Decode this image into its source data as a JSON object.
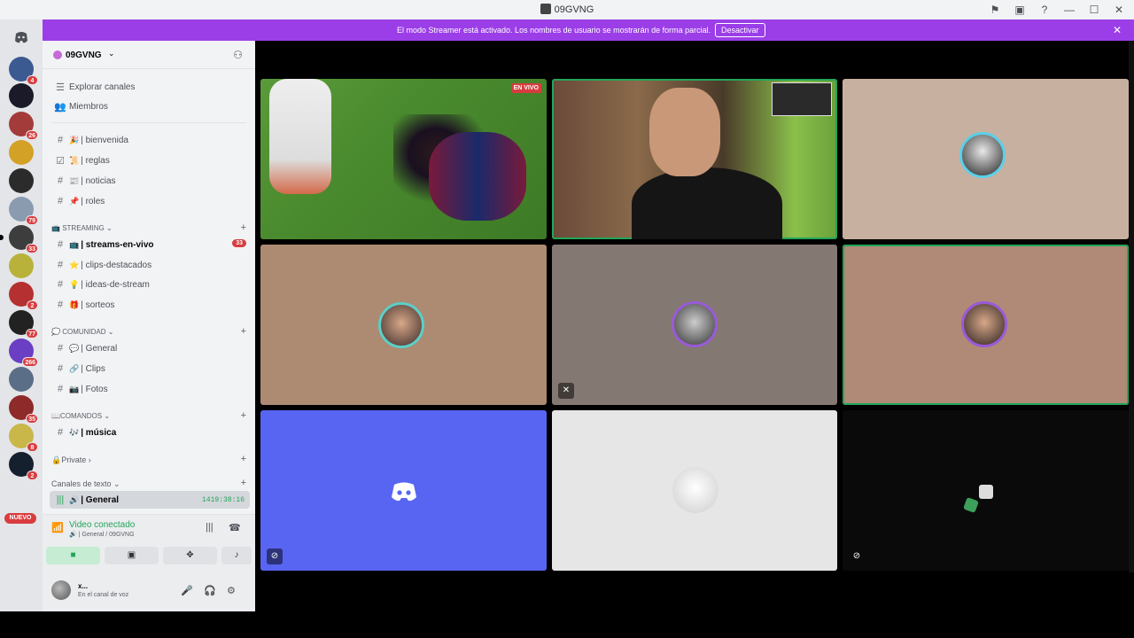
{
  "window": {
    "title": "09GVNG"
  },
  "banner": {
    "text": "El modo Streamer está activado. Los nombres de usuario se mostrarán de forma parcial.",
    "button": "Desactivar"
  },
  "server": {
    "name": "09GVNG"
  },
  "nav": {
    "explore": "Explorar canales",
    "members": "Miembros"
  },
  "channels_top": [
    {
      "emoji": "🎉",
      "name": "| bienvenida"
    },
    {
      "emoji": "📜",
      "name": "| reglas"
    },
    {
      "emoji": "📰",
      "name": "| noticias"
    },
    {
      "emoji": "📌",
      "name": "| roles"
    }
  ],
  "categories": {
    "streaming": "STREAMING",
    "comunidad": "COMUNIDAD",
    "comandos": "COMANDOS",
    "private": "Private",
    "texto": "Canales de texto"
  },
  "streaming_channels": [
    {
      "emoji": "📺",
      "name": "| streams-en-vivo",
      "count": "33",
      "bold": true
    },
    {
      "emoji": "⭐",
      "name": "| clips-destacados"
    },
    {
      "emoji": "💡",
      "name": "| ideas-de-stream"
    },
    {
      "emoji": "🎁",
      "name": "| sorteos"
    }
  ],
  "comunidad_channels": [
    {
      "emoji": "💬",
      "name": "| General"
    },
    {
      "emoji": "🔗",
      "name": "| Clips"
    },
    {
      "emoji": "📷",
      "name": "| Fotos"
    }
  ],
  "comandos_channels": [
    {
      "emoji": "🎶",
      "name": "| música",
      "bold": true
    }
  ],
  "voice_channel": {
    "name": "| General",
    "time": "1419:38:16"
  },
  "server_badges": [
    "4",
    "26",
    "79",
    "33",
    "2",
    "77",
    "266",
    "35",
    "8",
    "2"
  ],
  "new_label": "NUEVO",
  "voice": {
    "status": "Video conectado",
    "sub": "🔊 | General / 09GVNG"
  },
  "user": {
    "name": "x...",
    "status": "En el canal de voz"
  },
  "tiles": {
    "live_label": "EN VIVO"
  },
  "colors": {
    "banner": "#9b3ee8",
    "speaking": "#23a559",
    "blurple": "#5865f2"
  }
}
